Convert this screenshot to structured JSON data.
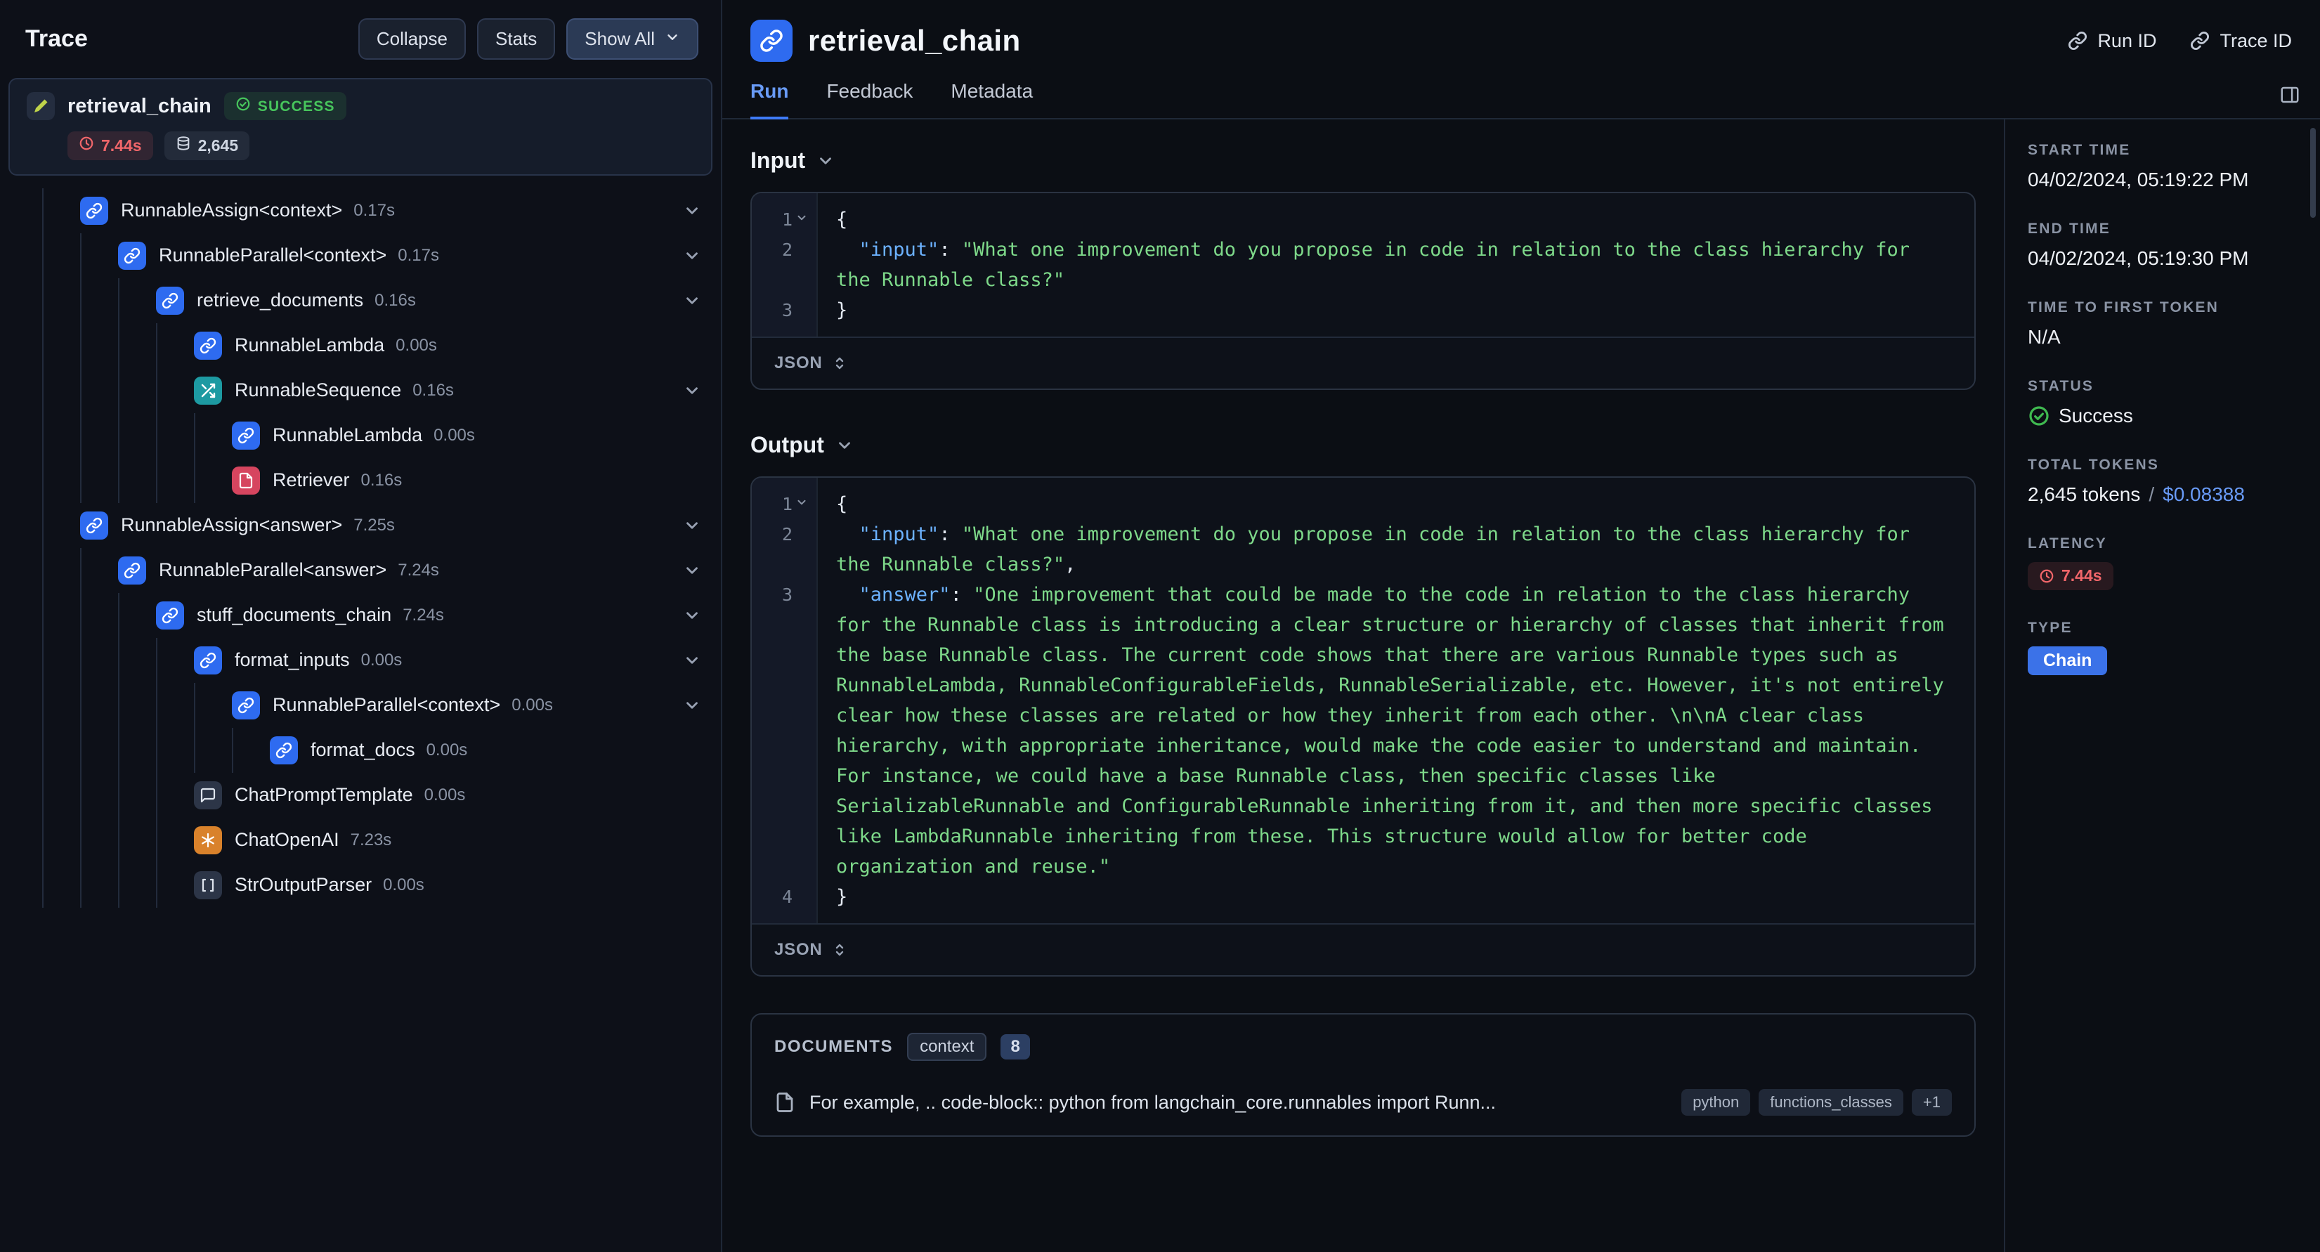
{
  "colors": {
    "background": "#0b0e14",
    "accent_blue": "#2e6bf0",
    "active_tab_blue": "#699bf7",
    "success_green": "#47c55c",
    "error_red": "#f1666a",
    "code_key": "#6cb2ff",
    "code_string": "#7ed98a",
    "type_badge": "#3b72e8",
    "icon_teal": "#1d9aa2",
    "icon_crimson": "#d6455f",
    "icon_orange": "#d9822b"
  },
  "trace_panel": {
    "title": "Trace",
    "buttons": {
      "collapse": "Collapse",
      "stats": "Stats",
      "show_all": "Show All"
    },
    "root": {
      "label": "retrieval_chain",
      "icon": "pen-icon",
      "status": "SUCCESS",
      "latency": "7.44s",
      "tokens": "2,645"
    },
    "items": [
      {
        "label": "RunnableAssign<context>",
        "duration": "0.17s",
        "level": 1,
        "icon": "link-icon",
        "color": "blue",
        "expandable": true
      },
      {
        "label": "RunnableParallel<context>",
        "duration": "0.17s",
        "level": 2,
        "icon": "link-icon",
        "color": "blue",
        "expandable": true
      },
      {
        "label": "retrieve_documents",
        "duration": "0.16s",
        "level": 3,
        "icon": "link-icon",
        "color": "blue",
        "expandable": true
      },
      {
        "label": "RunnableLambda",
        "duration": "0.00s",
        "level": 4,
        "icon": "link-icon",
        "color": "blue",
        "expandable": false
      },
      {
        "label": "RunnableSequence",
        "duration": "0.16s",
        "level": 4,
        "icon": "shuffle-icon",
        "color": "teal",
        "expandable": true
      },
      {
        "label": "RunnableLambda",
        "duration": "0.00s",
        "level": 5,
        "icon": "link-icon",
        "color": "blue",
        "expandable": false
      },
      {
        "label": "Retriever",
        "duration": "0.16s",
        "level": 5,
        "icon": "file-icon",
        "color": "crimson",
        "expandable": false
      },
      {
        "label": "RunnableAssign<answer>",
        "duration": "7.25s",
        "level": 1,
        "icon": "link-icon",
        "color": "blue",
        "expandable": true
      },
      {
        "label": "RunnableParallel<answer>",
        "duration": "7.24s",
        "level": 2,
        "icon": "link-icon",
        "color": "blue",
        "expandable": true
      },
      {
        "label": "stuff_documents_chain",
        "duration": "7.24s",
        "level": 3,
        "icon": "link-icon",
        "color": "blue",
        "expandable": true
      },
      {
        "label": "format_inputs",
        "duration": "0.00s",
        "level": 4,
        "icon": "link-icon",
        "color": "blue",
        "expandable": true
      },
      {
        "label": "RunnableParallel<context>",
        "duration": "0.00s",
        "level": 5,
        "icon": "link-icon",
        "color": "blue",
        "expandable": true
      },
      {
        "label": "format_docs",
        "duration": "0.00s",
        "level": 6,
        "icon": "link-icon",
        "color": "blue",
        "expandable": false
      },
      {
        "label": "ChatPromptTemplate",
        "duration": "0.00s",
        "level": 4,
        "icon": "chat-bubble-icon",
        "color": "slate",
        "expandable": false
      },
      {
        "label": "ChatOpenAI",
        "duration": "7.23s",
        "level": 4,
        "icon": "openai-icon",
        "color": "orange",
        "expandable": false
      },
      {
        "label": "StrOutputParser",
        "duration": "0.00s",
        "level": 4,
        "icon": "brackets-icon",
        "color": "slate",
        "expandable": false
      }
    ]
  },
  "header": {
    "title": "retrieval_chain",
    "icon": "link-icon",
    "run_id_label": "Run ID",
    "trace_id_label": "Trace ID"
  },
  "tabs": [
    {
      "label": "Run",
      "active": true
    },
    {
      "label": "Feedback",
      "active": false
    },
    {
      "label": "Metadata",
      "active": false
    }
  ],
  "input_section": {
    "title": "Input",
    "footer": "JSON",
    "lines": [
      {
        "num": "1",
        "fold": true,
        "segments": [
          {
            "c": "p",
            "t": "{"
          }
        ]
      },
      {
        "num": "2",
        "fold": false,
        "segments": [
          {
            "c": "p",
            "t": "  "
          },
          {
            "c": "k",
            "t": "\"input\""
          },
          {
            "c": "p",
            "t": ": "
          },
          {
            "c": "s",
            "t": "\"What one improvement do you propose in code in relation to the class hierarchy for the Runnable class?\""
          }
        ]
      },
      {
        "num": "3",
        "fold": false,
        "segments": [
          {
            "c": "p",
            "t": "}"
          }
        ]
      }
    ]
  },
  "output_section": {
    "title": "Output",
    "footer": "JSON",
    "lines": [
      {
        "num": "1",
        "fold": true,
        "segments": [
          {
            "c": "p",
            "t": "{"
          }
        ]
      },
      {
        "num": "2",
        "fold": false,
        "segments": [
          {
            "c": "p",
            "t": "  "
          },
          {
            "c": "k",
            "t": "\"input\""
          },
          {
            "c": "p",
            "t": ": "
          },
          {
            "c": "s",
            "t": "\"What one improvement do you propose in code in relation to the class hierarchy for the Runnable class?\""
          },
          {
            "c": "p",
            "t": ","
          }
        ]
      },
      {
        "num": "3",
        "fold": false,
        "segments": [
          {
            "c": "p",
            "t": "  "
          },
          {
            "c": "k",
            "t": "\"answer\""
          },
          {
            "c": "p",
            "t": ": "
          },
          {
            "c": "s",
            "t": "\"One improvement that could be made to the code in relation to the class hierarchy for the Runnable class is introducing a clear structure or hierarchy of classes that inherit from the base Runnable class. The current code shows that there are various Runnable types such as RunnableLambda, RunnableConfigurableFields, RunnableSerializable, etc. However, it's not entirely clear how these classes are related or how they inherit from each other. \\n\\nA clear class hierarchy, with appropriate inheritance, would make the code easier to understand and maintain. For instance, we could have a base Runnable class, then specific classes like SerializableRunnable and ConfigurableRunnable inheriting from it, and then more specific classes like LambdaRunnable inheriting from these. This structure would allow for better code organization and reuse.\""
          }
        ]
      },
      {
        "num": "4",
        "fold": false,
        "segments": [
          {
            "c": "p",
            "t": "}"
          }
        ]
      }
    ]
  },
  "documents_section": {
    "title": "DOCUMENTS",
    "context_badge": "context",
    "count": "8",
    "doc": {
      "text": "For example, .. code-block:: python from langchain_core.runnables import Runn...",
      "tags": [
        "python",
        "functions_classes"
      ],
      "more": "+1"
    }
  },
  "details_panel": {
    "fields": [
      {
        "label": "START TIME",
        "type": "text",
        "value": "04/02/2024, 05:19:22 PM"
      },
      {
        "label": "END TIME",
        "type": "text",
        "value": "04/02/2024, 05:19:30 PM"
      },
      {
        "label": "TIME TO FIRST TOKEN",
        "type": "text",
        "value": "N/A"
      },
      {
        "label": "STATUS",
        "type": "status",
        "value": "Success"
      },
      {
        "label": "TOTAL TOKENS",
        "type": "tokens",
        "value": "2,645 tokens",
        "separator": "/",
        "cost": "$0.08388"
      },
      {
        "label": "LATENCY",
        "type": "latency",
        "value": "7.44s"
      },
      {
        "label": "TYPE",
        "type": "type",
        "value": "Chain"
      }
    ]
  }
}
